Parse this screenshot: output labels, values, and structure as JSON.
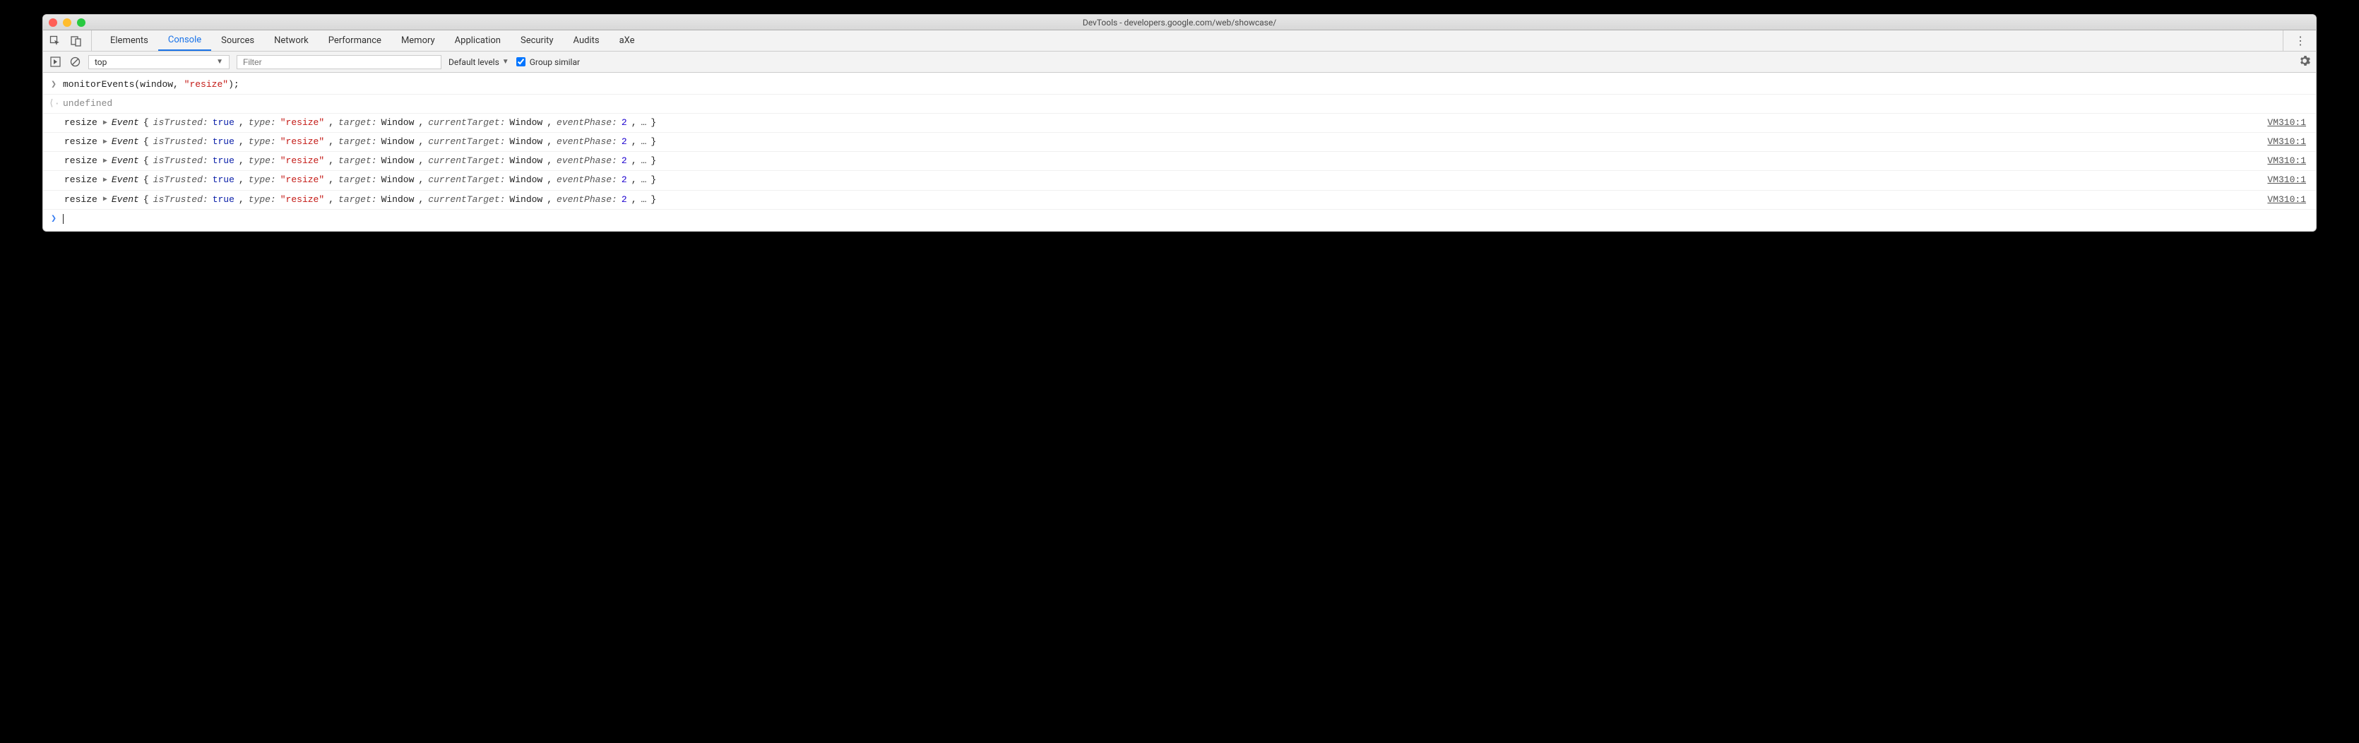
{
  "window": {
    "title": "DevTools - developers.google.com/web/showcase/"
  },
  "tabs": {
    "items": [
      "Elements",
      "Console",
      "Sources",
      "Network",
      "Performance",
      "Memory",
      "Application",
      "Security",
      "Audits",
      "aXe"
    ],
    "active": "Console"
  },
  "toolbar": {
    "context": "top",
    "filter_placeholder": "Filter",
    "levels_label": "Default levels",
    "group_similar_label": "Group similar",
    "group_similar_checked": true
  },
  "console": {
    "input": {
      "fn": "monitorEvents",
      "arg1": "window",
      "arg2": "\"resize\"",
      "raw": "monitorEvents(window, \"resize\");"
    },
    "output": "undefined",
    "events": [
      {
        "label": "resize",
        "class": "Event",
        "props": {
          "isTrusted": "true",
          "type": "\"resize\"",
          "target": "Window",
          "currentTarget": "Window",
          "eventPhase": "2"
        },
        "source": "VM310:1"
      },
      {
        "label": "resize",
        "class": "Event",
        "props": {
          "isTrusted": "true",
          "type": "\"resize\"",
          "target": "Window",
          "currentTarget": "Window",
          "eventPhase": "2"
        },
        "source": "VM310:1"
      },
      {
        "label": "resize",
        "class": "Event",
        "props": {
          "isTrusted": "true",
          "type": "\"resize\"",
          "target": "Window",
          "currentTarget": "Window",
          "eventPhase": "2"
        },
        "source": "VM310:1"
      },
      {
        "label": "resize",
        "class": "Event",
        "props": {
          "isTrusted": "true",
          "type": "\"resize\"",
          "target": "Window",
          "currentTarget": "Window",
          "eventPhase": "2"
        },
        "source": "VM310:1"
      },
      {
        "label": "resize",
        "class": "Event",
        "props": {
          "isTrusted": "true",
          "type": "\"resize\"",
          "target": "Window",
          "currentTarget": "Window",
          "eventPhase": "2"
        },
        "source": "VM310:1"
      }
    ]
  }
}
